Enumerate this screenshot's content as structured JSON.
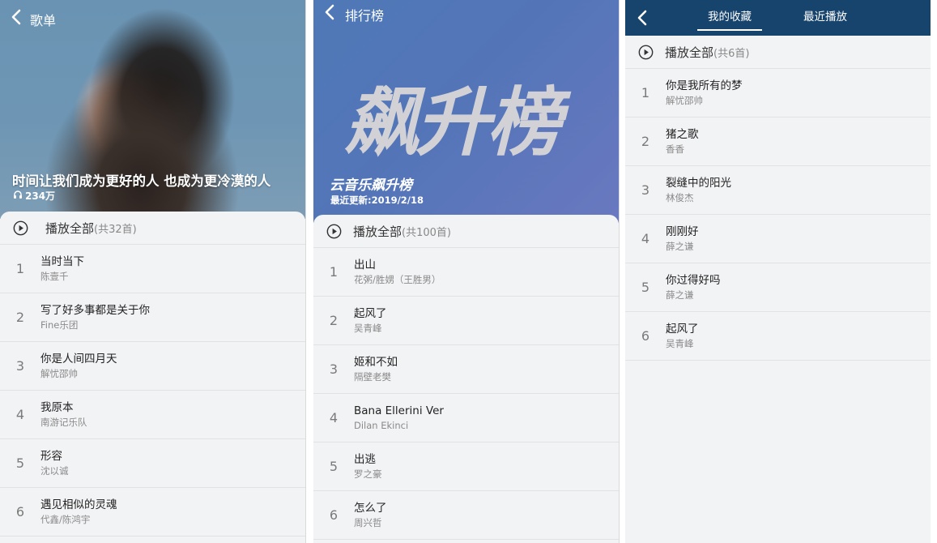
{
  "playlist": {
    "header_title": "歌单",
    "name": "时间让我们成为更好的人 也成为更冷漠的人",
    "play_count": "234万",
    "play_all": {
      "label": "播放全部",
      "count": "(共32首)"
    },
    "songs": [
      {
        "index": "1",
        "title": "当时当下",
        "artist": "陈壹千"
      },
      {
        "index": "2",
        "title": "写了好多事都是关于你",
        "artist": "Fine乐团"
      },
      {
        "index": "3",
        "title": "你是人间四月天",
        "artist": "解忧邵帅"
      },
      {
        "index": "4",
        "title": "我原本",
        "artist": "南游记乐队"
      },
      {
        "index": "5",
        "title": "形容",
        "artist": "沈以诚"
      },
      {
        "index": "6",
        "title": "遇见相似的灵魂",
        "artist": "代鑫/陈鸿宇"
      }
    ]
  },
  "ranking": {
    "header_title": "排行榜",
    "logo_text": "飙升榜",
    "chart_name": "云音乐飙升榜",
    "updated": "最近更新:2019/2/18",
    "play_all": {
      "label": "播放全部",
      "count": "(共100首)"
    },
    "songs": [
      {
        "index": "1",
        "title": "出山",
        "artist": "花粥/胜娚（王胜男）"
      },
      {
        "index": "2",
        "title": "起风了",
        "artist": "吴青峰"
      },
      {
        "index": "3",
        "title": "姬和不如",
        "artist": "隔壁老樊"
      },
      {
        "index": "4",
        "title": "Bana Ellerini Ver",
        "artist": "Dilan Ekinci"
      },
      {
        "index": "5",
        "title": "出逃",
        "artist": "罗之豪"
      },
      {
        "index": "6",
        "title": "怎么了",
        "artist": "周兴哲"
      }
    ]
  },
  "collection": {
    "tabs": [
      "我的收藏",
      "最近播放"
    ],
    "play_all": {
      "label": "播放全部",
      "count": "(共6首)"
    },
    "songs": [
      {
        "index": "1",
        "title": "你是我所有的梦",
        "artist": "解忧邵帅"
      },
      {
        "index": "2",
        "title": "猪之歌",
        "artist": "香香"
      },
      {
        "index": "3",
        "title": "裂缝中的阳光",
        "artist": "林俊杰"
      },
      {
        "index": "4",
        "title": "刚刚好",
        "artist": "薛之谦"
      },
      {
        "index": "5",
        "title": "你过得好吗",
        "artist": "薛之谦"
      },
      {
        "index": "6",
        "title": "起风了",
        "artist": "吴青峰"
      }
    ]
  },
  "colors": {
    "topbar": "#17446d",
    "panel_bg": "#f2f3f5",
    "ranking_hero": "#5375b8"
  },
  "icons": {
    "back": "chevron-left-icon",
    "play_all": "play-circle-icon",
    "play_count": "headphones-icon"
  }
}
